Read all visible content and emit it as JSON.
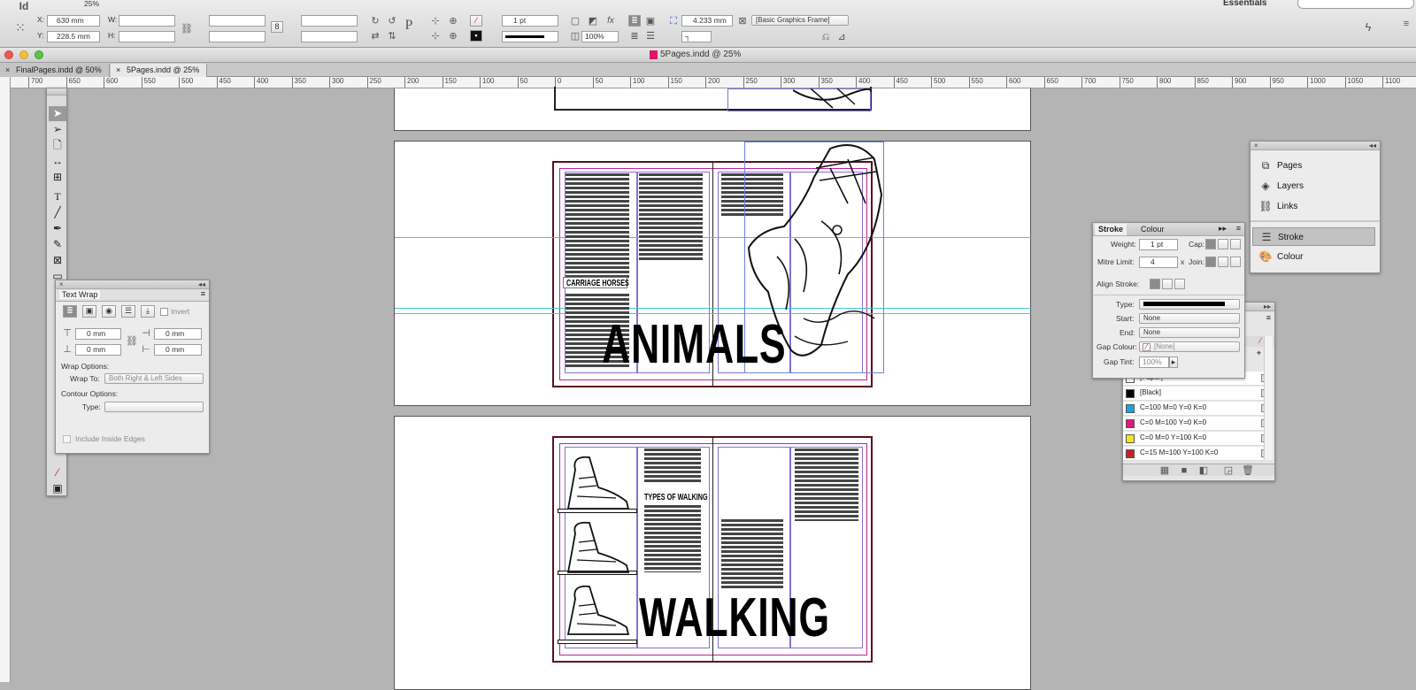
{
  "app": {
    "mode": "Essentials",
    "window_title": "5Pages.indd @ 25%",
    "zoom": "25%"
  },
  "control": {
    "x_label": "X:",
    "x_value": "630 mm",
    "y_label": "Y:",
    "y_value": "228.5 mm",
    "w_label": "W:",
    "h_label": "H:",
    "stroke_weight": "1 pt",
    "opacity": "100%",
    "offset": "4.233 mm",
    "object_style": "[Basic Graphics Frame]"
  },
  "tabs": [
    {
      "label": "FinalPages.indd @ 50%"
    },
    {
      "label": "5Pages.indd @ 25%"
    }
  ],
  "ruler": {
    "h_ticks": [
      "700",
      "650",
      "600",
      "550",
      "500",
      "450",
      "400",
      "350",
      "300",
      "250",
      "200",
      "150",
      "100",
      "50",
      "0",
      "50",
      "100",
      "150",
      "200",
      "250",
      "300",
      "350",
      "400",
      "450",
      "500",
      "550",
      "600",
      "650",
      "700",
      "750",
      "800",
      "850",
      "900",
      "950",
      "1000",
      "1050",
      "1100"
    ]
  },
  "spreads": {
    "animals_heading": "ANIMALS",
    "animals_sub": "CARRIAGE HORSES",
    "walking_heading": "WALKING",
    "walking_sub": "TYPES OF WALKING"
  },
  "textwrap": {
    "title": "Text Wrap",
    "invert": "Invert",
    "top": "0 mm",
    "bottom": "0 mm",
    "left": "0 mm",
    "right": "0 mm",
    "wrap_options": "Wrap Options:",
    "wrap_to_label": "Wrap To:",
    "wrap_to": "Both Right & Left Sides",
    "contour_options": "Contour Options:",
    "type_label": "Type:",
    "include_inside": "Include Inside Edges"
  },
  "stroke": {
    "tab_stroke": "Stroke",
    "tab_colour": "Colour",
    "weight_label": "Weight:",
    "weight": "1 pt",
    "cap_label": "Cap:",
    "mitre_label": "Mitre Limit:",
    "mitre": "4",
    "x": "x",
    "join_label": "Join:",
    "align_label": "Align Stroke:",
    "type_label": "Type:",
    "start_label": "Start:",
    "start": "None",
    "end_label": "End:",
    "end": "None",
    "gap_colour_label": "Gap Colour:",
    "gap_colour": "[None]",
    "gap_tint_label": "Gap Tint:",
    "gap_tint": "100%"
  },
  "swatches": [
    {
      "name": "[Paper]",
      "color": "#ffffff"
    },
    {
      "name": "[Black]",
      "color": "#000000"
    },
    {
      "name": "C=100 M=0 Y=0 K=0",
      "color": "#1aa5e0"
    },
    {
      "name": "C=0 M=100 Y=0 K=0",
      "color": "#e0177f"
    },
    {
      "name": "C=0 M=0 Y=100 K=0",
      "color": "#f5e51a"
    },
    {
      "name": "C=15 M=100 Y=100 K=0",
      "color": "#c8202b"
    }
  ],
  "panels": {
    "pages": "Pages",
    "layers": "Layers",
    "links": "Links",
    "stroke": "Stroke",
    "colour": "Colour"
  }
}
